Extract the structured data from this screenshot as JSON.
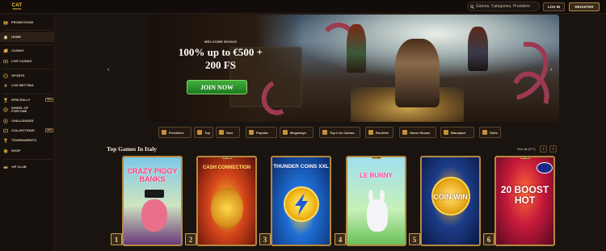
{
  "header": {
    "logo_line1": "CAT",
    "logo_line2": "PIRATE",
    "search_placeholder": "Games, Categories, Providers",
    "login_label": "LOG IN",
    "register_label": "REGISTER"
  },
  "sidebar": {
    "items": [
      {
        "label": "PROMOTIONS",
        "icon": "gift-icon"
      },
      {
        "label": "HOME",
        "icon": "home-icon"
      },
      {
        "label": "CASINO",
        "icon": "cards-icon"
      },
      {
        "label": "LIVE CASINO",
        "icon": "live-icon"
      },
      {
        "label": "SPORTS",
        "icon": "ball-icon"
      },
      {
        "label": "LIVE BETTING",
        "icon": "lightning-icon"
      },
      {
        "label": "SPIN RALLY",
        "icon": "trophy-icon",
        "badge": "NEW"
      },
      {
        "label": "WHEEL OF FORTUNE",
        "icon": "wheel-icon"
      },
      {
        "label": "CHALLENGES",
        "icon": "target-icon"
      },
      {
        "label": "COLLECTIONS",
        "icon": "album-icon",
        "badge": "NEW"
      },
      {
        "label": "TOURNAMENTS",
        "icon": "cup-icon"
      },
      {
        "label": "SHOP",
        "icon": "shop-icon"
      },
      {
        "label": "VIP CLUB",
        "icon": "crown-icon"
      }
    ],
    "active_index": 1
  },
  "hero": {
    "welcome": "WELCOME BONUS",
    "offer_line1": "100% up to €500 +",
    "offer_line2": "200 FS",
    "cta": "JOIN NOW"
  },
  "categories": [
    {
      "label": "Providers"
    },
    {
      "label": "Top"
    },
    {
      "label": "New"
    },
    {
      "label": "Popular"
    },
    {
      "label": "Megaways"
    },
    {
      "label": "Top Live Casino"
    },
    {
      "label": "Roulette"
    },
    {
      "label": "Game Shows"
    },
    {
      "label": "Blackjack"
    },
    {
      "label": "Slots"
    }
  ],
  "top_games": {
    "title": "Top Games In Italy",
    "see_all": "See all (577)",
    "games": [
      {
        "rank": "1",
        "name": "CRAZY PIGGY BANKS",
        "tag": "NEW"
      },
      {
        "rank": "2",
        "name": "CASH CONNECTION",
        "tag": "NEW"
      },
      {
        "rank": "3",
        "name": "THUNDER COINS XXL",
        "tag": ""
      },
      {
        "rank": "4",
        "name": "LE BUNNY",
        "tag": "NEW"
      },
      {
        "rank": "5",
        "name": "COIN WIN",
        "tag": ""
      },
      {
        "rank": "6",
        "name": "20 BOOST HOT",
        "tag": "NEW"
      }
    ]
  },
  "colors": {
    "accent_gold": "#c9a04a",
    "cta_green": "#2a9a2e",
    "background": "#1a1410"
  }
}
